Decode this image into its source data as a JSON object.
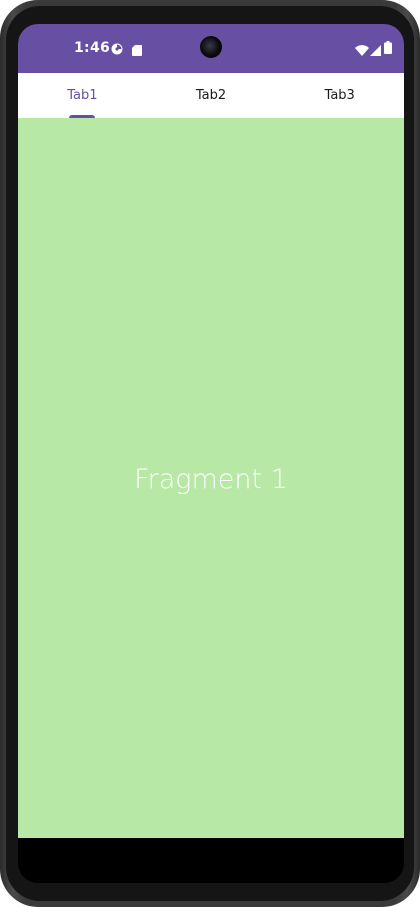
{
  "status_bar": {
    "time": "1:46",
    "background_color": "#6750a4",
    "left_icons": [
      "assistant-icon",
      "sd-card-icon"
    ],
    "right_icons": [
      "wifi-icon",
      "cell-signal-icon",
      "battery-icon"
    ]
  },
  "tabs": [
    {
      "label": "Tab1",
      "selected": true
    },
    {
      "label": "Tab2",
      "selected": false
    },
    {
      "label": "Tab3",
      "selected": false
    }
  ],
  "accent_color": "#6750a4",
  "content": {
    "label": "Fragment 1",
    "background_color": "#b7e8a6"
  }
}
